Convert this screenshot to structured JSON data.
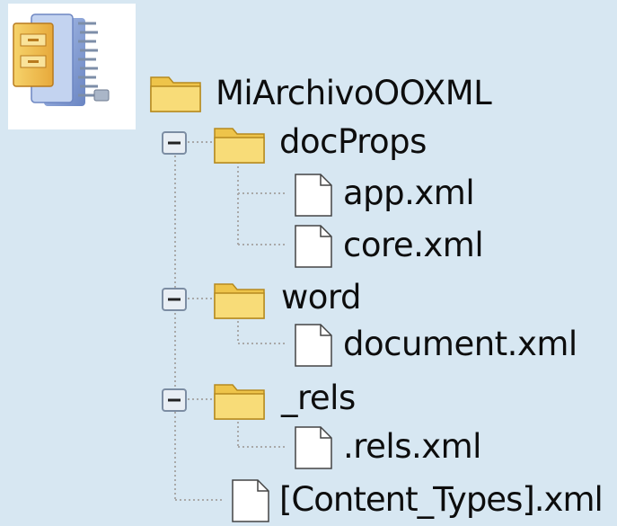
{
  "tree": {
    "root": {
      "label": "MiArchivoOOXML",
      "icon": "folder-icon"
    },
    "docProps": {
      "label": "docProps",
      "expanded": true,
      "children": [
        {
          "label": "app.xml",
          "icon": "file-icon"
        },
        {
          "label": "core.xml",
          "icon": "file-icon"
        }
      ]
    },
    "word": {
      "label": "word",
      "expanded": true,
      "children": [
        {
          "label": "document.xml",
          "icon": "file-icon"
        }
      ]
    },
    "rels": {
      "label": "_rels",
      "expanded": true,
      "children": [
        {
          "label": ".rels.xml",
          "icon": "file-icon"
        }
      ]
    },
    "content_types": {
      "label": "[Content_Types].xml",
      "icon": "file-icon"
    }
  },
  "colors": {
    "background": "#d7e7f2",
    "folder": "#f3d35e",
    "connector": "#a9a9a9"
  }
}
